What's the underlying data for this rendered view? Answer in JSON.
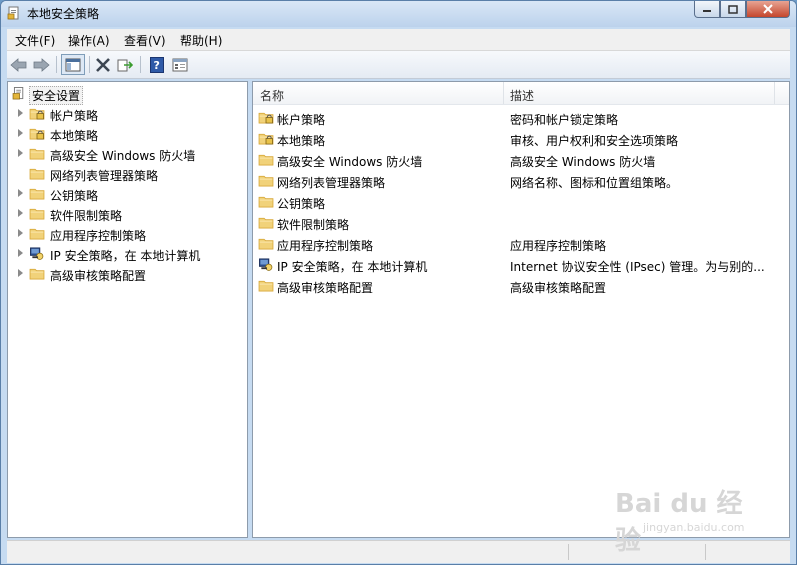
{
  "window": {
    "title": "本地安全策略"
  },
  "menu": [
    "文件(F)",
    "操作(A)",
    "查看(V)",
    "帮助(H)"
  ],
  "toolbar": {
    "buttons": [
      "back-icon",
      "forward-icon",
      "show-hide-tree-icon",
      "delete-icon",
      "export-list-icon",
      "help-icon",
      "properties-icon"
    ]
  },
  "tree": {
    "root": "安全设置",
    "items": [
      {
        "label": "帐户策略",
        "icon": "policy-folder-icon",
        "expandable": true
      },
      {
        "label": "本地策略",
        "icon": "policy-folder-icon",
        "expandable": true
      },
      {
        "label": "高级安全 Windows 防火墙",
        "icon": "folder-icon",
        "expandable": true
      },
      {
        "label": "网络列表管理器策略",
        "icon": "folder-icon",
        "expandable": false
      },
      {
        "label": "公钥策略",
        "icon": "folder-icon",
        "expandable": true
      },
      {
        "label": "软件限制策略",
        "icon": "folder-icon",
        "expandable": true
      },
      {
        "label": "应用程序控制策略",
        "icon": "folder-icon",
        "expandable": true
      },
      {
        "label": "IP 安全策略，在 本地计算机",
        "icon": "ip-security-icon",
        "expandable": true
      },
      {
        "label": "高级审核策略配置",
        "icon": "folder-icon",
        "expandable": true
      }
    ]
  },
  "list": {
    "columns": [
      "名称",
      "描述"
    ],
    "rows": [
      {
        "name": "帐户策略",
        "desc": "密码和帐户锁定策略",
        "icon": "policy-folder-icon"
      },
      {
        "name": "本地策略",
        "desc": "审核、用户权利和安全选项策略",
        "icon": "policy-folder-icon"
      },
      {
        "name": "高级安全 Windows 防火墙",
        "desc": "高级安全 Windows 防火墙",
        "icon": "folder-icon"
      },
      {
        "name": "网络列表管理器策略",
        "desc": "网络名称、图标和位置组策略。",
        "icon": "folder-icon"
      },
      {
        "name": "公钥策略",
        "desc": "",
        "icon": "folder-icon"
      },
      {
        "name": "软件限制策略",
        "desc": "",
        "icon": "folder-icon"
      },
      {
        "name": "应用程序控制策略",
        "desc": "应用程序控制策略",
        "icon": "folder-icon"
      },
      {
        "name": "IP 安全策略，在 本地计算机",
        "desc": "Internet 协议安全性 (IPsec) 管理。为与别的...",
        "icon": "ip-security-icon"
      },
      {
        "name": "高级审核策略配置",
        "desc": "高级审核策略配置",
        "icon": "folder-icon"
      }
    ]
  },
  "watermark": {
    "main": "Bai du 经验",
    "sub": "jingyan.baidu.com"
  },
  "colors": {
    "folder": "#f1d27a",
    "folder_dark": "#d8a93a",
    "selection": "#f3f3f3",
    "frame": "#c6dbf1"
  }
}
